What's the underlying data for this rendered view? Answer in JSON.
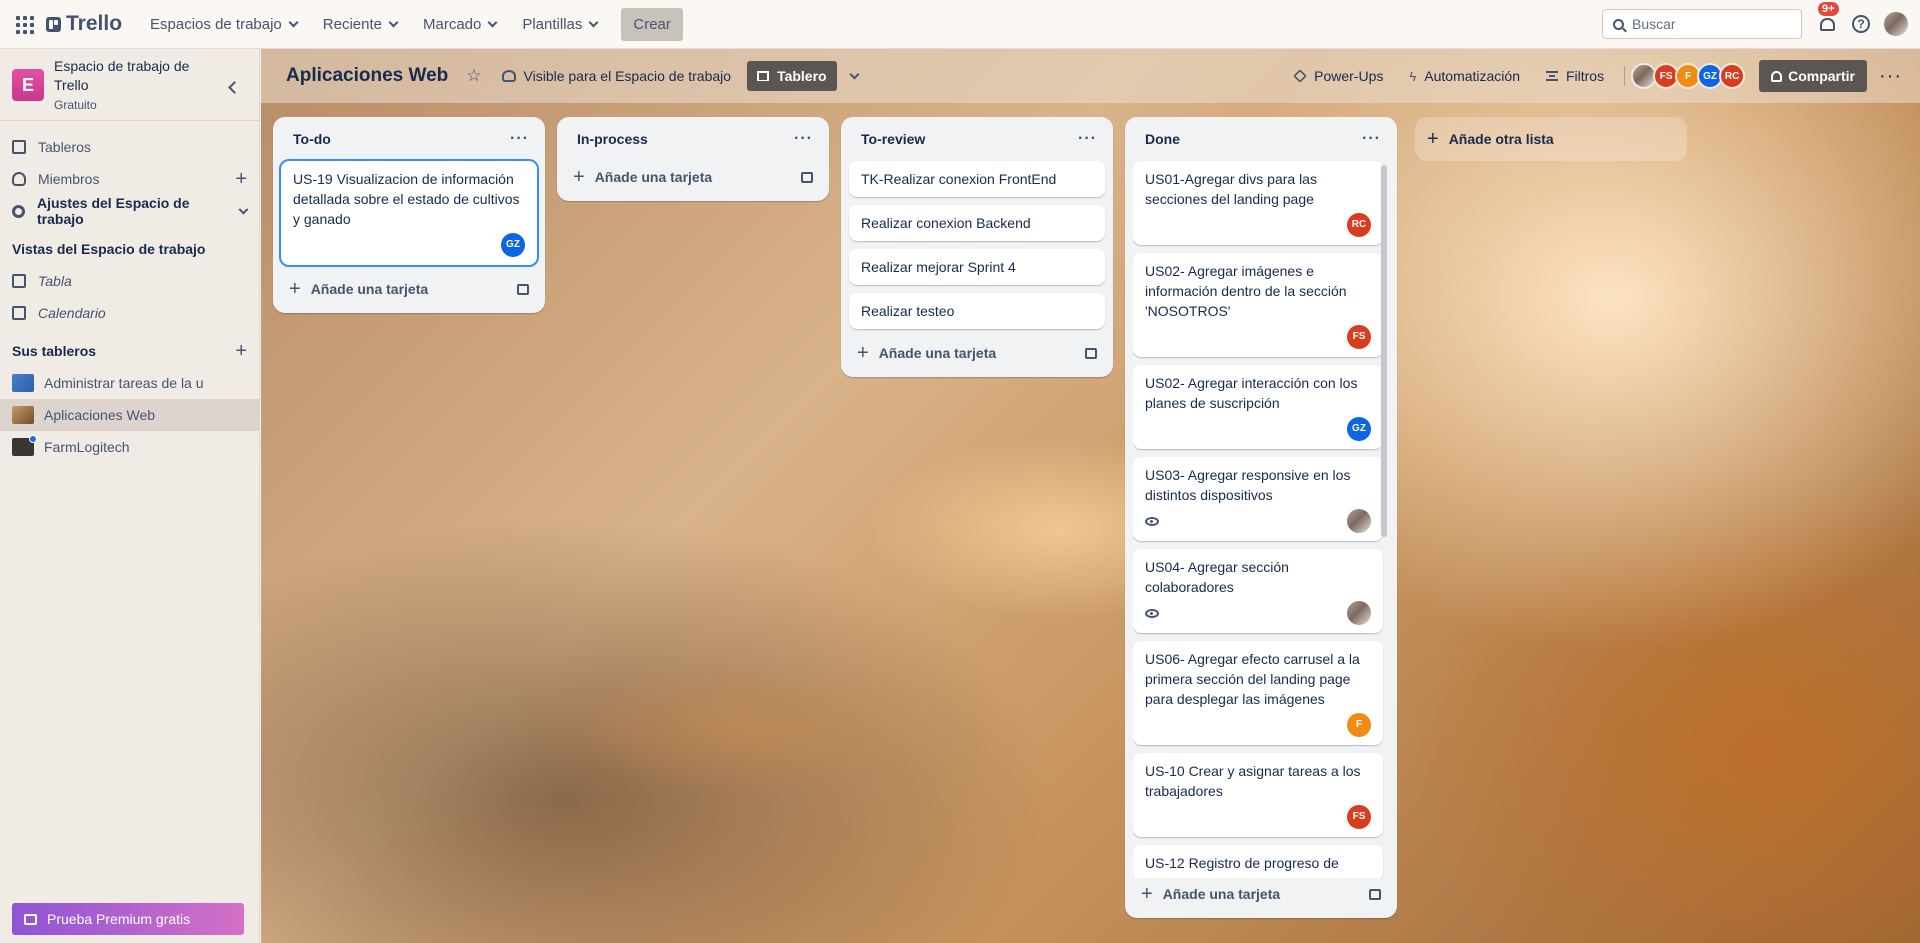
{
  "topbar": {
    "logo": "Trello",
    "nav": [
      {
        "label": "Espacios de trabajo"
      },
      {
        "label": "Reciente"
      },
      {
        "label": "Marcado"
      },
      {
        "label": "Plantillas"
      }
    ],
    "create_label": "Crear",
    "search_placeholder": "Buscar",
    "notification_count": "9+",
    "help_glyph": "?"
  },
  "sidebar": {
    "workspace_initial": "E",
    "workspace_name": "Espacio de trabajo de Trello",
    "workspace_plan": "Gratuito",
    "items": [
      {
        "label": "Tableros"
      },
      {
        "label": "Miembros"
      },
      {
        "label": "Ajustes del Espacio de trabajo"
      }
    ],
    "views_heading": "Vistas del Espacio de trabajo",
    "views": [
      {
        "label": "Tabla"
      },
      {
        "label": "Calendario"
      }
    ],
    "boards_heading": "Sus tableros",
    "boards": [
      {
        "label": "Administrar tareas de la u"
      },
      {
        "label": "Aplicaciones Web"
      },
      {
        "label": "FarmLogitech"
      }
    ],
    "premium_label": "Prueba Premium gratis"
  },
  "board": {
    "title": "Aplicaciones Web",
    "visibility": "Visible para el Espacio de trabajo",
    "view_label": "Tablero",
    "actions": [
      {
        "label": "Power-Ups"
      },
      {
        "label": "Automatización"
      },
      {
        "label": "Filtros"
      }
    ],
    "members": [
      "",
      "FS",
      "F",
      "GZ",
      "RC"
    ],
    "share_label": "Compartir",
    "add_list_label": "Añade otra lista"
  },
  "lists": [
    {
      "title": "To-do",
      "add_label": "Añade una tarjeta",
      "cards": [
        {
          "text": "US-19 Visualizacion de información detallada sobre el estado de cultivos y ganado",
          "member": "GZ"
        }
      ]
    },
    {
      "title": "In-process",
      "add_label": "Añade una tarjeta",
      "cards": []
    },
    {
      "title": "To-review",
      "add_label": "Añade una tarjeta",
      "cards": [
        {
          "text": "TK-Realizar conexion FrontEnd"
        },
        {
          "text": "Realizar conexion Backend"
        },
        {
          "text": "Realizar mejorar Sprint 4"
        },
        {
          "text": "Realizar testeo"
        }
      ]
    },
    {
      "title": "Done",
      "add_label": "Añade una tarjeta",
      "cards": [
        {
          "text": "US01-Agregar divs para las secciones del landing page",
          "member": "RC"
        },
        {
          "text": "US02- Agregar imágenes e información dentro de la sección 'NOSOTROS'",
          "member": "FS"
        },
        {
          "text": "US02- Agregar interacción con los planes de suscripción",
          "member": "GZ"
        },
        {
          "text": "US03- Agregar responsive en los distintos dispositivos",
          "member": ""
        },
        {
          "text": "US04- Agregar sección colaboradores",
          "member": ""
        },
        {
          "text": "US06- Agregar efecto carrusel a la primera sección del landing page para desplegar las imágenes",
          "member": "F"
        },
        {
          "text": "US-10 Crear y asignar tareas a los trabajadores",
          "member": "FS"
        },
        {
          "text": "US-12 Registro de progreso de"
        }
      ]
    }
  ],
  "colors": {
    "red_avatar": "#d93c1e",
    "orange_avatar": "#f08b13",
    "blue_avatar": "#0c66e4",
    "workspace_badge": "#e351a4",
    "focus_ring": "#388bff"
  }
}
